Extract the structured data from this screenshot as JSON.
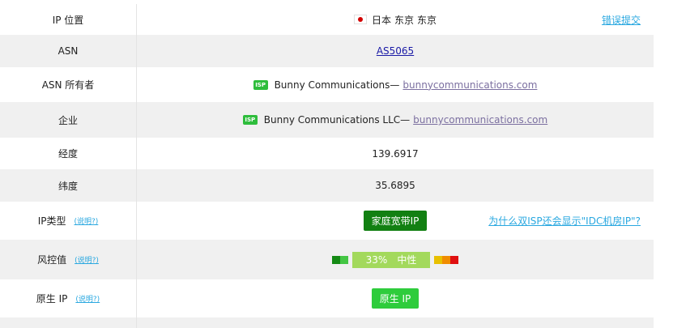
{
  "rows": [
    {
      "label": "IP 位置",
      "country": "日本",
      "region": "东京",
      "city": "东京",
      "action": "错误提交"
    },
    {
      "label": "ASN",
      "value": "AS5065"
    },
    {
      "label": "ASN 所有者",
      "badge": "ISP",
      "name": "Bunny Communications",
      "sep": "—",
      "domain": "bunnycommunications.com"
    },
    {
      "label": "企业",
      "badge": "ISP",
      "name": "Bunny Communications LLC",
      "sep": "—",
      "domain": "bunnycommunications.com"
    },
    {
      "label": "经度",
      "value": "139.6917"
    },
    {
      "label": "纬度",
      "value": "35.6895"
    },
    {
      "label": "IP类型",
      "help": "(说明?)",
      "value": "家庭宽带IP",
      "action": "为什么双ISP还会显示\"IDC机房IP\"?"
    },
    {
      "label": "风控值",
      "help": "(说明?)",
      "score": "33%",
      "level": "中性"
    },
    {
      "label": "原生 IP",
      "help": "(说明?)",
      "value": "原生 IP"
    }
  ],
  "colors": {
    "risk_left": [
      "#148a14",
      "#44c644"
    ],
    "risk_right": [
      "#e8c000",
      "#f08c00",
      "#e01010"
    ]
  }
}
